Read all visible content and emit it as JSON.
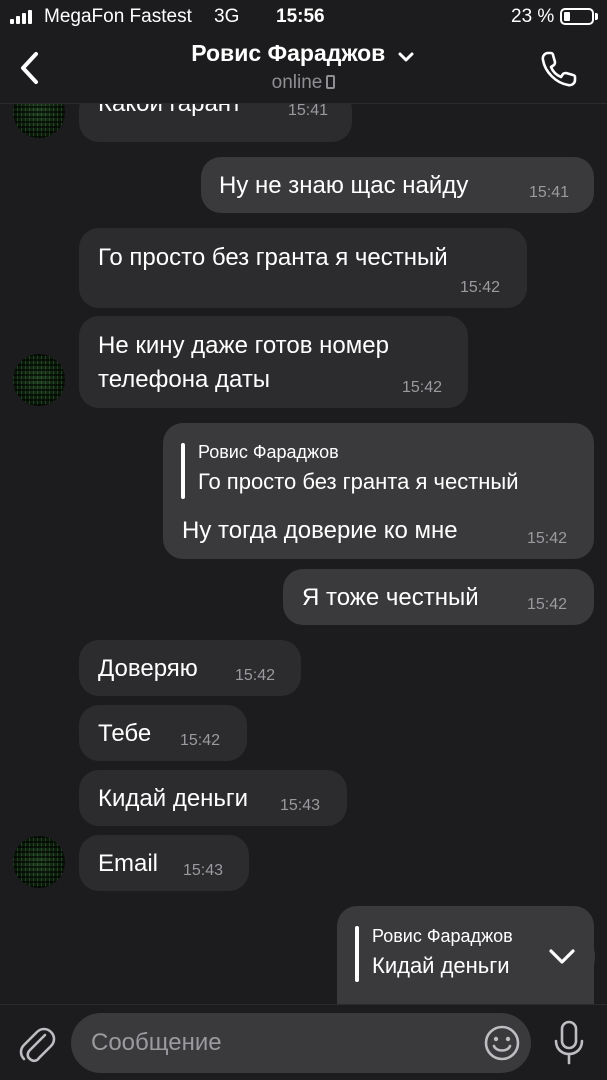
{
  "status_bar": {
    "carrier": "MegaFon Fastest",
    "network": "3G",
    "time": "15:56",
    "battery": "23 %",
    "battery_level_pct": 23
  },
  "header": {
    "back_icon": "chevron-left-icon",
    "title": "Ровис Фараджов",
    "title_chevron_icon": "chevron-down-icon",
    "status": "online",
    "status_icon": "mobile-phone-icon",
    "call_icon": "phone-icon"
  },
  "messages": [
    {
      "direction": "in",
      "text": "Какой гарант",
      "time": "15:41"
    },
    {
      "direction": "out",
      "text": "Ну не знаю щас найду",
      "time": "15:41"
    },
    {
      "direction": "in",
      "text": "Го просто без гранта я честный",
      "time": "15:42"
    },
    {
      "direction": "in",
      "text_line1": "Не кину даже готов номер",
      "text_line2": "телефона даты",
      "time": "15:42"
    },
    {
      "direction": "out",
      "reply_to_name": "Ровис Фараджов",
      "reply_to_text": "Го просто без гранта я честный",
      "text": "Ну тогда доверие ко мне",
      "time": "15:42"
    },
    {
      "direction": "out",
      "text": "Я тоже честный",
      "time": "15:42"
    },
    {
      "direction": "in",
      "text": "Доверяю",
      "time": "15:42"
    },
    {
      "direction": "in",
      "text": "Тебе",
      "time": "15:42"
    },
    {
      "direction": "in",
      "text": "Кидай деньги",
      "time": "15:43"
    },
    {
      "direction": "in",
      "text": "Email",
      "time": "15:43"
    },
    {
      "direction": "out",
      "reply_to_name": "Ровис Фараджов",
      "reply_to_text": "Кидай деньги"
    }
  ],
  "scroll_down_icon": "chevron-down-icon",
  "input_bar": {
    "attach_icon": "paperclip-icon",
    "placeholder": "Сообщение",
    "emoji_icon": "smiley-icon",
    "mic_icon": "microphone-icon"
  },
  "colors": {
    "background": "#1c1c1e",
    "bubble_in": "#2c2c2e",
    "bubble_out": "#3a3a3c",
    "secondary_text": "#8e8e93"
  }
}
